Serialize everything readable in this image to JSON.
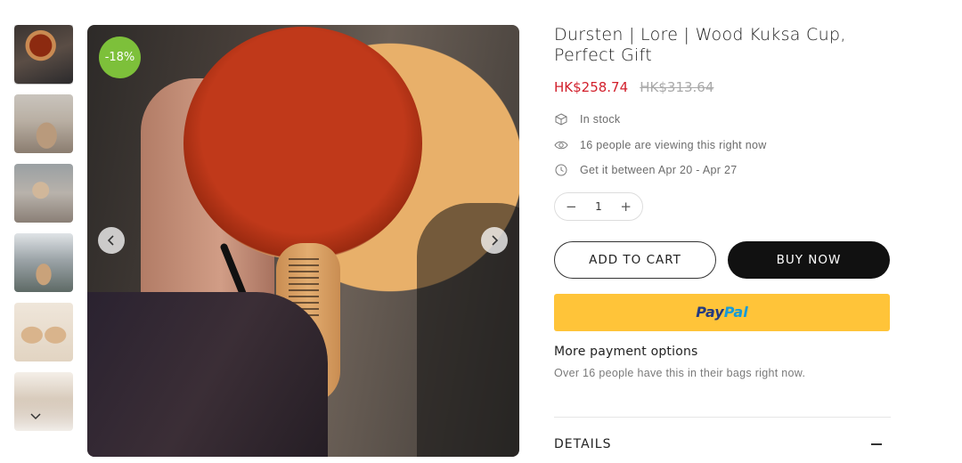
{
  "gallery": {
    "discount_badge": "-18%",
    "prev_icon": "chevron-left-icon",
    "next_icon": "chevron-right-icon",
    "thumbs_scroll_icon": "chevron-down-icon"
  },
  "product": {
    "title": "Dursten | Lore | Wood Kuksa Cup, Perfect Gift",
    "price_current": "HK$258.74",
    "price_original": "HK$313.64",
    "stock_status": "In stock",
    "viewers": "16 people are viewing this right now",
    "delivery": "Get it between Apr 20 - Apr 27"
  },
  "quantity": {
    "value": "1",
    "decrement": "−",
    "increment": "+"
  },
  "buttons": {
    "add_to_cart": "ADD TO CART",
    "buy_now": "BUY NOW",
    "paypal_part1": "Pay",
    "paypal_part2": "Pal",
    "more_payment": "More payment options"
  },
  "social_proof": "Over 16 people have this in their bags right now.",
  "accordion": {
    "details_label": "DETAILS"
  },
  "colors": {
    "sale_price": "#d2202c",
    "badge": "#7dc03a",
    "paypal_bg": "#ffc439",
    "buy_now_bg": "#111111"
  }
}
